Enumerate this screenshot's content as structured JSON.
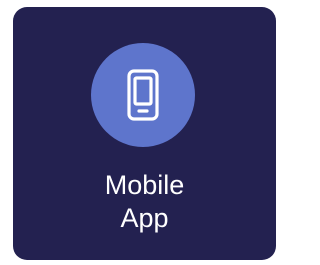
{
  "tile": {
    "label_line1": "Mobile",
    "label_line2": "App",
    "icon": "mobile-phone-icon",
    "colors": {
      "background": "#232150",
      "icon_circle": "#5e75cc",
      "text": "#ffffff"
    }
  }
}
